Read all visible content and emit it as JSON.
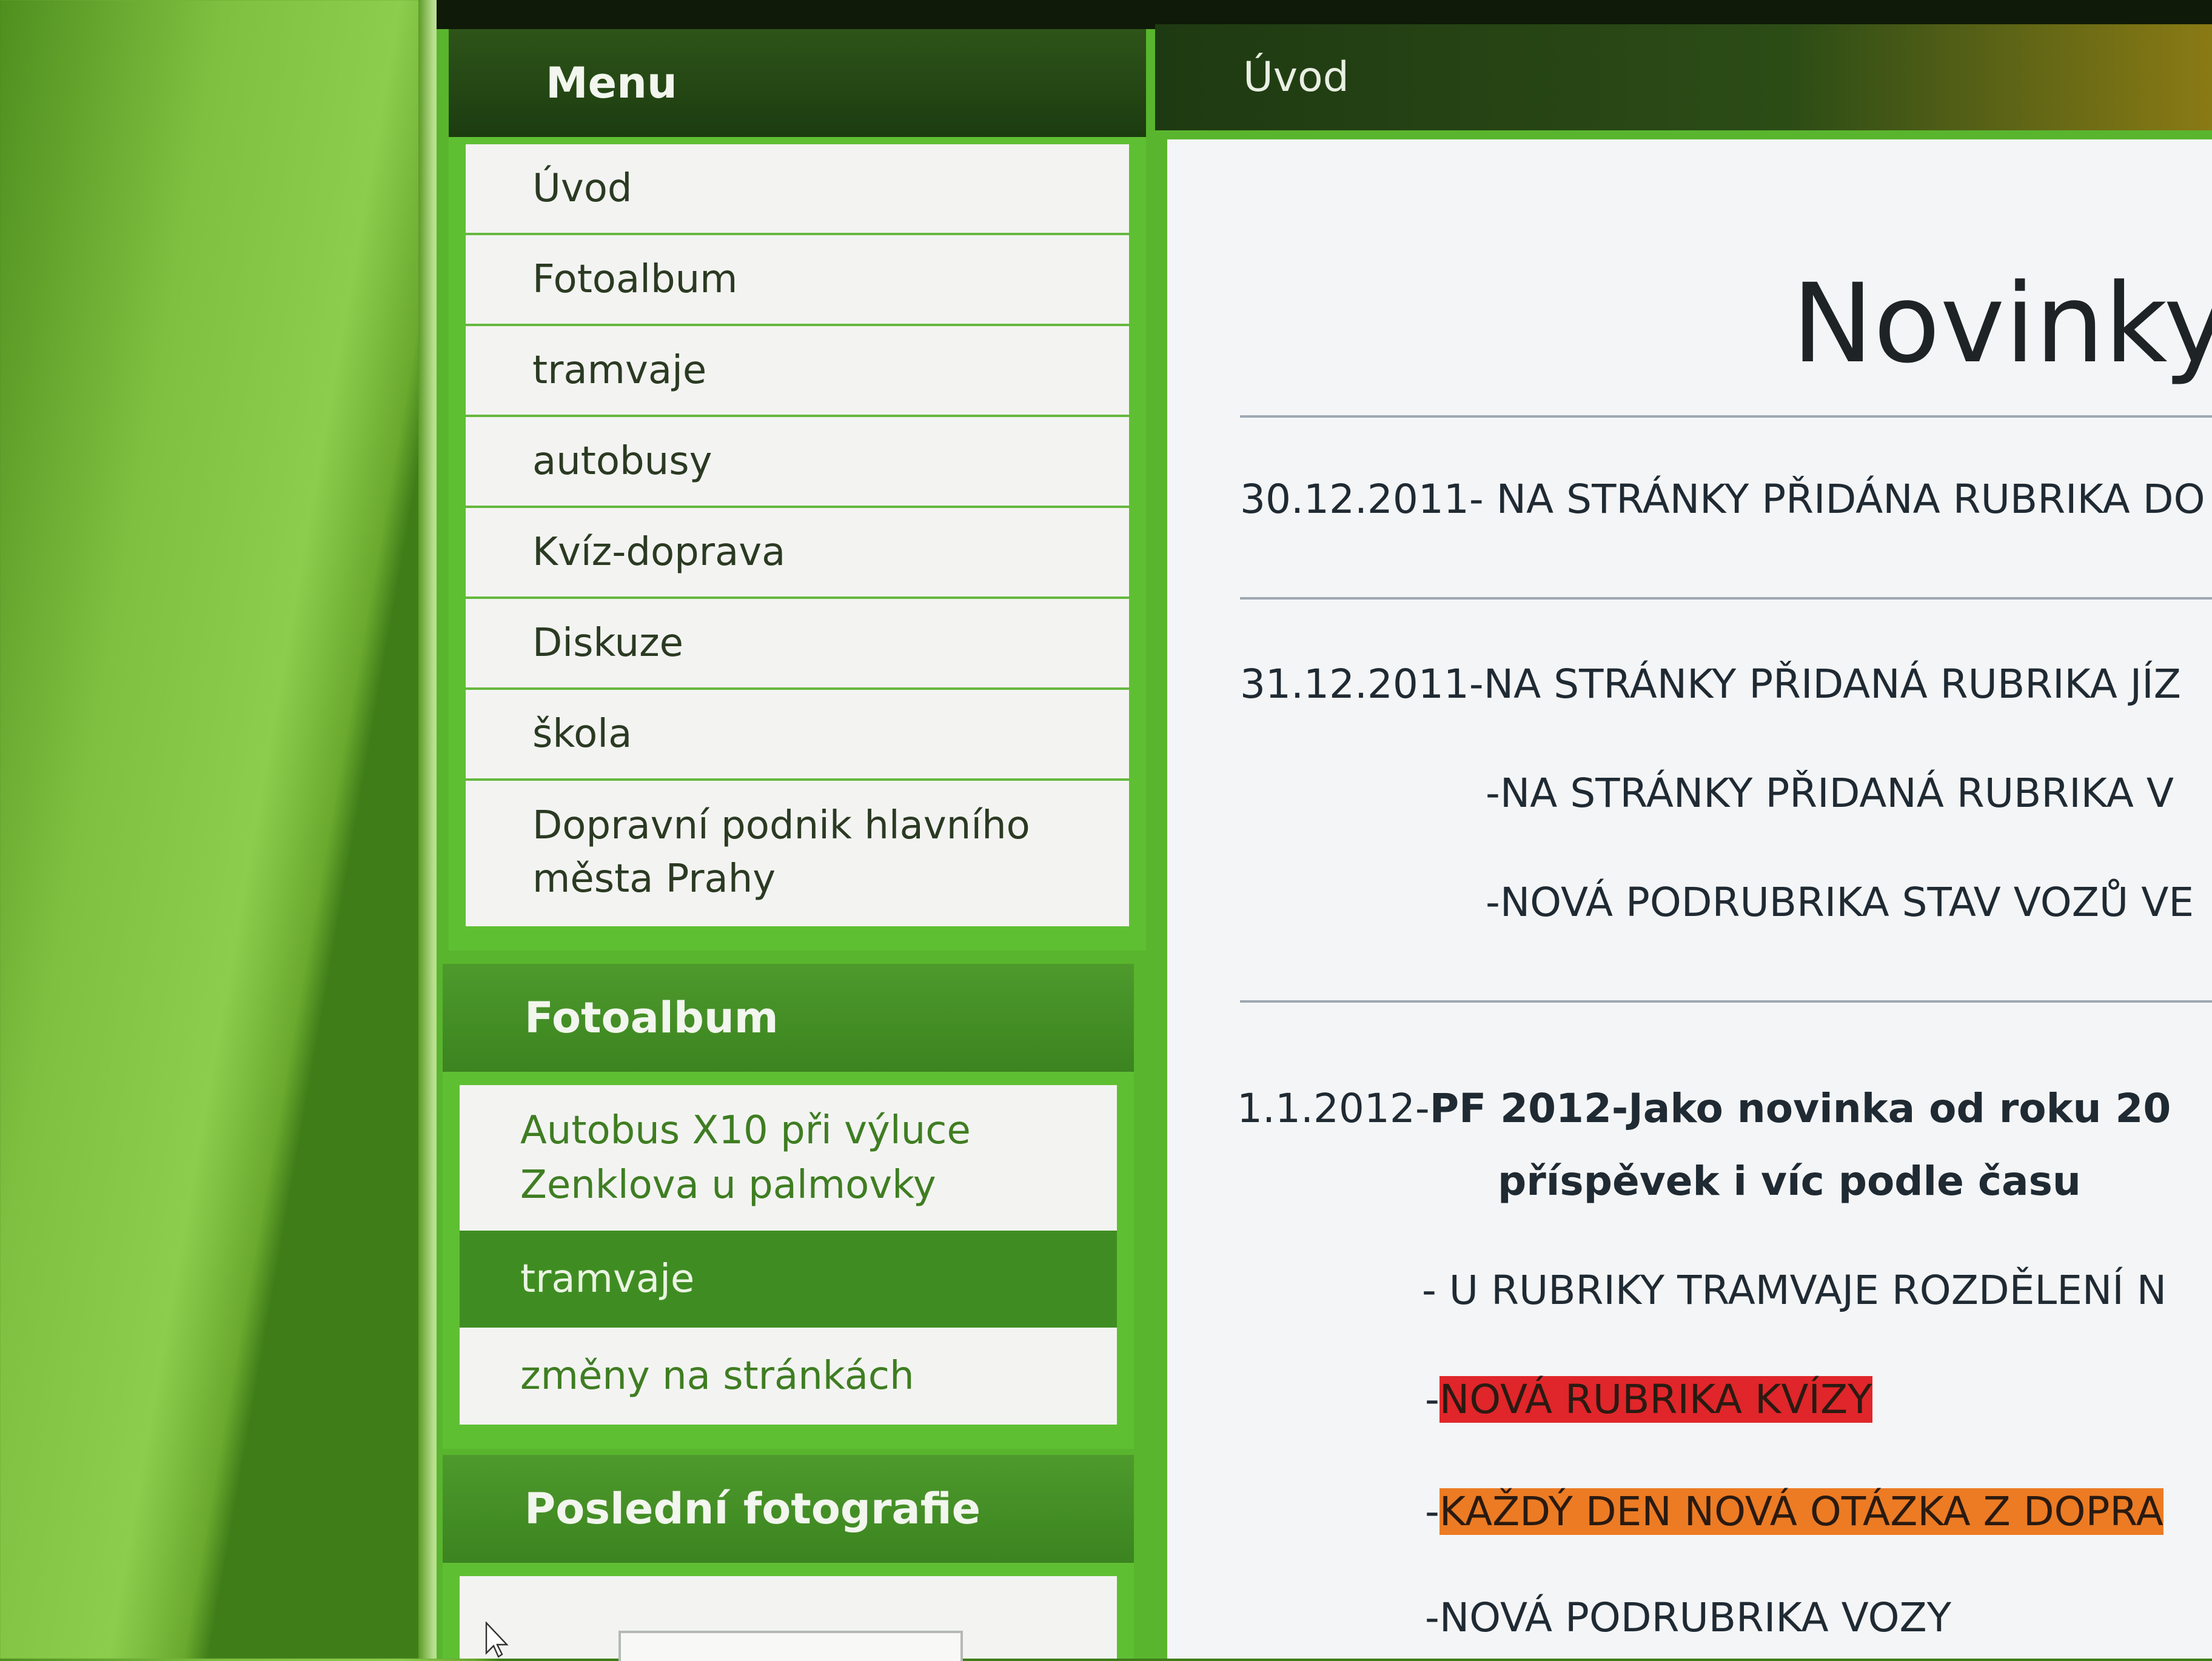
{
  "topbar": {},
  "menu": {
    "title": "Menu",
    "items": [
      {
        "label": "Úvod"
      },
      {
        "label": "Fotoalbum"
      },
      {
        "label": "tramvaje"
      },
      {
        "label": "autobusy"
      },
      {
        "label": "Kvíz-doprava"
      },
      {
        "label": "Diskuze"
      },
      {
        "label": "škola"
      },
      {
        "label": "Dopravní podnik hlavního města Prahy"
      }
    ]
  },
  "fotoalbum": {
    "title": "Fotoalbum",
    "items": [
      {
        "label": "Autobus X10 při výluce Zenklova u palmovky",
        "active": false
      },
      {
        "label": "tramvaje",
        "active": true
      },
      {
        "label": "změny na stránkách",
        "active": false
      }
    ]
  },
  "last_photos": {
    "title": "Poslední fotografie"
  },
  "content": {
    "breadcrumb": "Úvod",
    "heading": "Novinky",
    "news": [
      {
        "text": "30.12.2011- NA STRÁNKY PŘIDÁNA RUBRIKA DO"
      },
      {
        "text": "31.12.2011-NA STRÁNKY PŘIDANÁ RUBRIKA JÍZ"
      },
      {
        "text": "-NA STRÁNKY PŘIDANÁ RUBRIKA V"
      },
      {
        "text": "-NOVÁ PODRUBRIKA STAV VOZŮ VE"
      },
      {
        "date": "1.1.2012-",
        "bold1": "PF 2012-Jako novinka od roku 20",
        "bold2": "příspěvek i víc podle času"
      },
      {
        "text": "- U RUBRIKY TRAMVAJE ROZDĚLENÍ N"
      },
      {
        "prefix": "-",
        "highlight": "NOVÁ RUBRIKA KVÍZY"
      },
      {
        "prefix": "-",
        "highlight": "KAŽDÝ DEN NOVÁ OTÁZKA Z  DOPRA"
      },
      {
        "text": "-NOVÁ PODRUBRIKA VOZY"
      }
    ]
  },
  "colors": {
    "accent": "#5fbf33",
    "header_dark": "#1c3c10",
    "active": "#3f8d22",
    "highlight_red": "#e0262a",
    "highlight_orange": "#ec7b24"
  }
}
